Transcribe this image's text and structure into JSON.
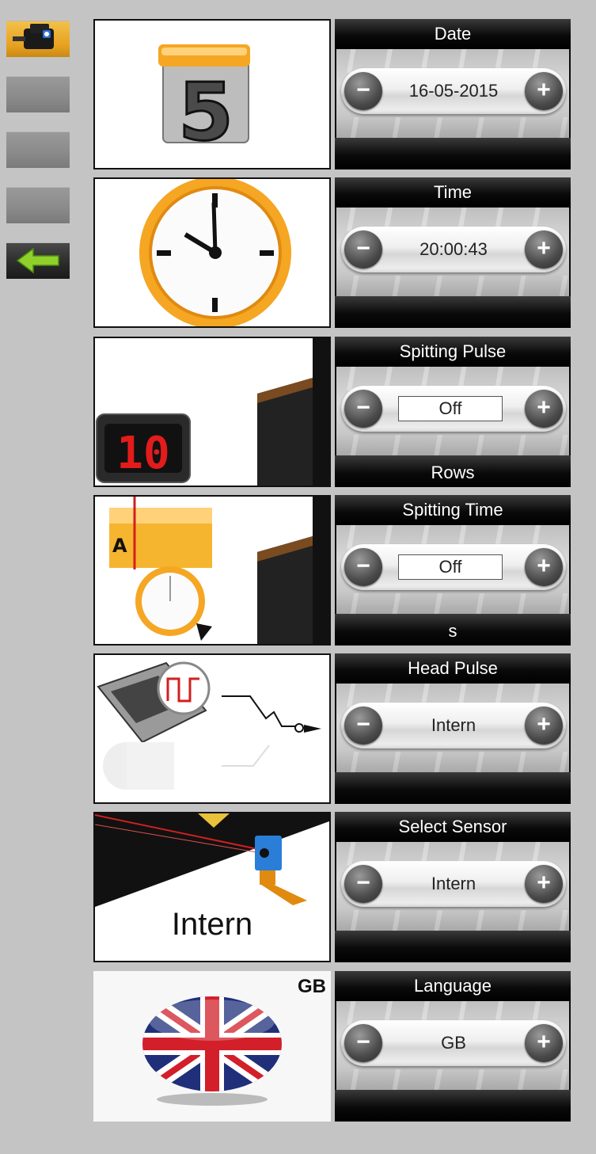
{
  "sidebar": {
    "items": [
      {
        "icon": "printer-icon",
        "state": "active"
      },
      {
        "icon": "",
        "state": "normal"
      },
      {
        "icon": "",
        "state": "normal"
      },
      {
        "icon": "",
        "state": "normal"
      },
      {
        "icon": "back-arrow-icon",
        "state": "normal"
      }
    ]
  },
  "settings": [
    {
      "title": "Date",
      "value": "16-05-2015",
      "footer": "",
      "icon": "calendar-icon"
    },
    {
      "title": "Time",
      "value": "20:00:43",
      "footer": "",
      "icon": "clock-icon"
    },
    {
      "title": "Spitting Pulse",
      "value": "Off",
      "footer": "Rows",
      "icon": "digital-counter-icon"
    },
    {
      "title": "Spitting Time",
      "value": "Off",
      "footer": "s",
      "icon": "timer-icon"
    },
    {
      "title": "Head Pulse",
      "value": "Intern",
      "footer": "",
      "icon": "pulse-signal-icon"
    },
    {
      "title": "Select Sensor",
      "value": "Intern",
      "footer": "",
      "icon": "sensor-icon",
      "thumb_label": "Intern"
    },
    {
      "title": "Language",
      "value": "GB",
      "footer": "",
      "icon": "uk-flag-icon",
      "thumb_label": "GB"
    }
  ],
  "colors": {
    "background": "#c4c4c4",
    "active_accent": "#e6a020",
    "panel_dark": "#0c0c0c",
    "plus_minus": "#4a4a4a"
  }
}
